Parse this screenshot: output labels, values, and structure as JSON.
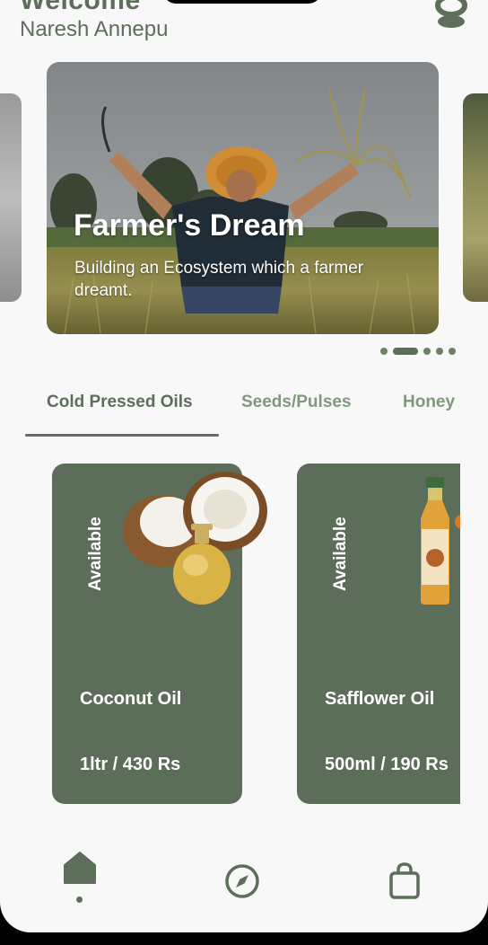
{
  "header": {
    "welcome": "Welcome",
    "user_name": "Naresh Annepu",
    "logo_icon": "brand-logo-icon"
  },
  "carousel": {
    "active_index": 1,
    "total_slides": 5,
    "slide": {
      "title": "Farmer's Dream",
      "subtitle": "Building an Ecosystem which a farmer dreamt."
    }
  },
  "tabs": [
    {
      "label": "Cold Pressed Oils",
      "selected": true
    },
    {
      "label": "Seeds/Pulses",
      "selected": false
    },
    {
      "label": "Honey",
      "selected": false
    }
  ],
  "products": [
    {
      "status": "Available",
      "name": "Coconut Oil",
      "price": "1ltr / 430 Rs",
      "image_icon": "coconut-oil-image"
    },
    {
      "status": "Available",
      "name": "Safflower Oil",
      "price": "500ml / 190 Rs",
      "image_icon": "safflower-oil-bottle-image"
    }
  ],
  "bottom_nav": [
    {
      "icon": "home-icon",
      "active": true
    },
    {
      "icon": "compass-icon",
      "active": false
    },
    {
      "icon": "shopping-bag-icon",
      "active": false
    }
  ],
  "colors": {
    "primary": "#5d6f5a",
    "card": "#5c6e59",
    "tab_inactive": "#7f9a7b",
    "background": "#f8f8f8"
  }
}
